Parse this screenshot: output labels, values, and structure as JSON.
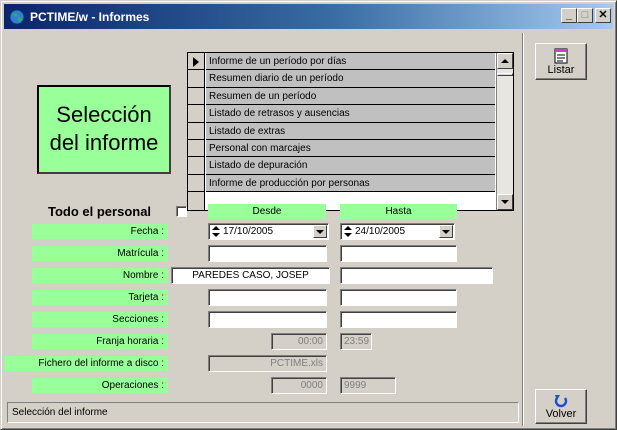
{
  "window": {
    "title": "PCTIME/w - Informes",
    "controls": {
      "minimize": "_",
      "maximize": "□",
      "close": "✕"
    }
  },
  "selection_title": "Selección del informe",
  "report_list": [
    "Informe de un período por días",
    "Resumen diario de un período",
    "Resumen de un período",
    "Listado de retrasos y ausencias",
    "Listado de extras",
    "Personal con marcajes",
    "Listado de depuración",
    "Informe de producción por personas"
  ],
  "buttons": {
    "listar": "Listar",
    "volver": "Volver"
  },
  "todo_personal": "Todo el personal",
  "headers": {
    "desde": "Desde",
    "hasta": "Hasta"
  },
  "labels": {
    "fecha": "Fecha :",
    "matricula": "Matrícula :",
    "nombre": "Nombre :",
    "tarjeta": "Tarjeta :",
    "secciones": "Secciones :",
    "franja": "Franja horaria :",
    "fichero": "Fichero del informe a disco :",
    "operaciones": "Operaciones :"
  },
  "values": {
    "fecha_desde": "17/10/2005",
    "fecha_hasta": "24/10/2005",
    "nombre_desde": "PAREDES CASO, JOSEP",
    "franja_desde": "00:00",
    "franja_hasta": "23:59",
    "fichero": "PCTIME.xls",
    "oper_desde": "0000",
    "oper_hasta": "9999"
  },
  "status": "Selección del informe",
  "colors": {
    "accent_green": "#99ff99",
    "title_bar": "#0a246a"
  }
}
